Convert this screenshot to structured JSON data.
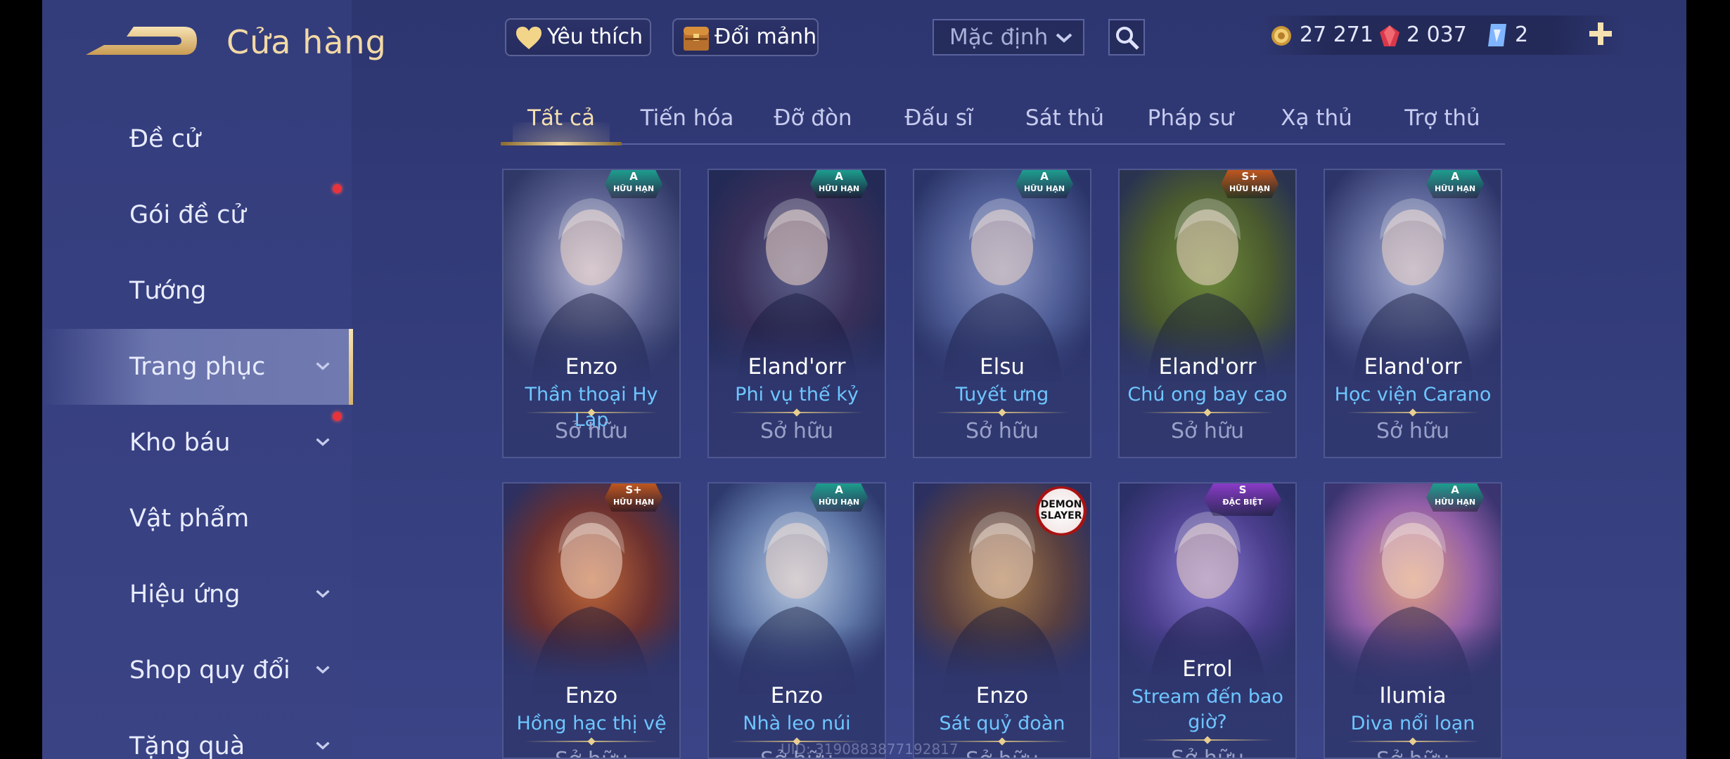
{
  "header": {
    "title": "Cửa hàng",
    "favorite_label": "Yêu thích",
    "exchange_label": "Đổi mảnh",
    "sort_value": "Mặc định",
    "currencies": [
      {
        "icon": "gold-coin-icon",
        "value": "27 271"
      },
      {
        "icon": "red-gem-icon",
        "value": "2 037"
      },
      {
        "icon": "blue-card-icon",
        "value": "2"
      }
    ]
  },
  "sidebar": {
    "items": [
      {
        "label": "Đề cử",
        "has_chevron": false,
        "red_dot": false
      },
      {
        "label": "Gói đề cử",
        "has_chevron": false,
        "red_dot": true
      },
      {
        "label": "Tướng",
        "has_chevron": false,
        "red_dot": false
      },
      {
        "label": "Trang phục",
        "has_chevron": true,
        "red_dot": false,
        "active": true
      },
      {
        "label": "Kho báu",
        "has_chevron": true,
        "red_dot": true
      },
      {
        "label": "Vật phẩm",
        "has_chevron": false,
        "red_dot": false
      },
      {
        "label": "Hiệu ứng",
        "has_chevron": true,
        "red_dot": false
      },
      {
        "label": "Shop quy đổi",
        "has_chevron": true,
        "red_dot": false
      },
      {
        "label": "Tặng quà",
        "has_chevron": true,
        "red_dot": false
      }
    ]
  },
  "tabs": [
    {
      "label": "Tất cả",
      "active": true
    },
    {
      "label": "Tiến hóa"
    },
    {
      "label": "Đỡ đòn"
    },
    {
      "label": "Đấu sĩ"
    },
    {
      "label": "Sát thủ"
    },
    {
      "label": "Pháp sư"
    },
    {
      "label": "Xạ thủ"
    },
    {
      "label": "Trợ thủ"
    }
  ],
  "cards": [
    {
      "hero": "Enzo",
      "skin": "Thần thoại Hy Lạp",
      "status": "Sở hữu",
      "badge_grade": "A",
      "badge_sub": "HỮU HẠN",
      "badge_color": "#1d9e8e"
    },
    {
      "hero": "Eland'orr",
      "skin": "Phi vụ thế kỷ",
      "status": "Sở hữu",
      "badge_grade": "A",
      "badge_sub": "HỮU HẠN",
      "badge_color": "#1d9e8e"
    },
    {
      "hero": "Elsu",
      "skin": "Tuyết ưng",
      "status": "Sở hữu",
      "badge_grade": "A",
      "badge_sub": "HỮU HẠN",
      "badge_color": "#1d9e8e"
    },
    {
      "hero": "Eland'orr",
      "skin": "Chú ong bay cao",
      "status": "Sở hữu",
      "badge_grade": "S+",
      "badge_sub": "HỮU HẠN",
      "badge_color": "#c0571e"
    },
    {
      "hero": "Eland'orr",
      "skin": "Học viện Carano",
      "status": "Sở hữu",
      "badge_grade": "A",
      "badge_sub": "HỮU HẠN",
      "badge_color": "#1d9e8e"
    },
    {
      "hero": "Enzo",
      "skin": "Hồng hạc thị vệ",
      "status": "Sở hữu",
      "badge_grade": "S+",
      "badge_sub": "HỮU HẠN",
      "badge_color": "#c0571e"
    },
    {
      "hero": "Enzo",
      "skin": "Nhà leo núi",
      "status": "Sở hữu",
      "badge_grade": "A",
      "badge_sub": "HỮU HẠN",
      "badge_color": "#1d9e8e"
    },
    {
      "hero": "Enzo",
      "skin": "Sát quỷ đoàn",
      "status": "Sở hữu",
      "badge_grade": "DEMON SLAYER",
      "badge_sub": "",
      "badge_color": "#ffffff"
    },
    {
      "hero": "Errol",
      "skin": "Stream đến bao giờ?",
      "status": "Sở hữu",
      "badge_grade": "S",
      "badge_sub": "ĐẶC BIỆT",
      "badge_color": "#8a3cc8"
    },
    {
      "hero": "Ilumia",
      "skin": "Diva nổi loạn",
      "status": "Sở hữu",
      "badge_grade": "A",
      "badge_sub": "HỮU HẠN",
      "badge_color": "#1d9e8e"
    }
  ],
  "uid_text": "UID: 3190883877192817",
  "colors": {
    "accent_gold": "#f2d9a6",
    "skin_blue": "#6ec6ff",
    "bg": "#333c7a"
  }
}
